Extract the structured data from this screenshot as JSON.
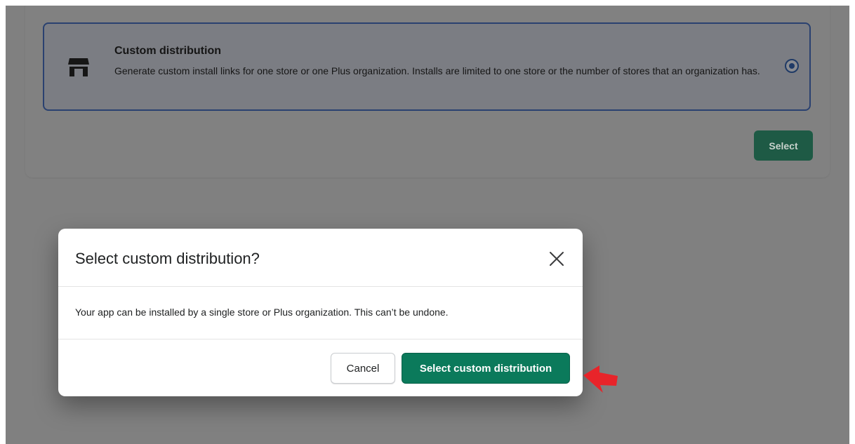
{
  "background_card": {
    "option": {
      "icon": "store-icon",
      "title": "Custom distribution",
      "description": "Generate custom install links for one store or one Plus organization. Installs are limited to one store or the number of stores that an organization has.",
      "selected": true
    },
    "select_label": "Select"
  },
  "modal": {
    "title": "Select custom distribution?",
    "close_icon": "close-icon",
    "body": "Your app can be installed by a single store or Plus organization. This can’t be undone.",
    "cancel_label": "Cancel",
    "confirm_label": "Select custom distribution"
  },
  "annotation": {
    "icon": "red-arrow-icon",
    "color": "#e8242a"
  },
  "colors": {
    "overlay": "#808080",
    "primary": "#0b7a5b",
    "selected_border": "#2a4170"
  }
}
